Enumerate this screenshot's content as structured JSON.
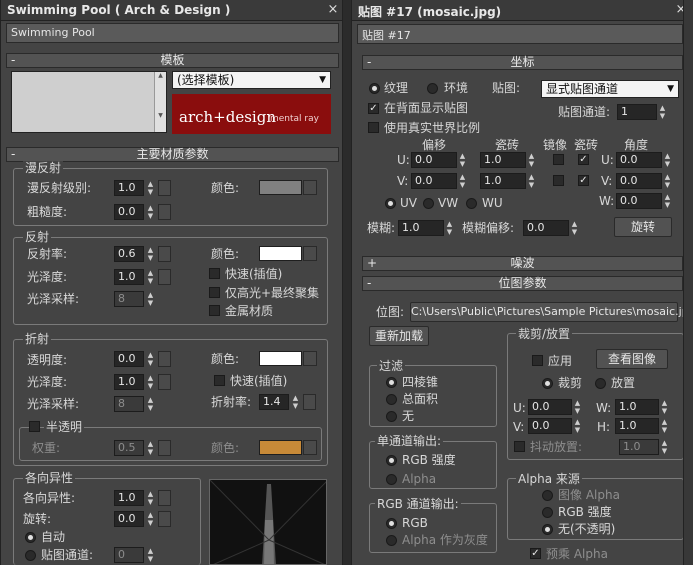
{
  "left": {
    "title": "Swimming Pool  ( Arch & Design )",
    "name_value": "Swimming Pool",
    "template_rollout": "模板",
    "template_dropdown": "(选择模板)",
    "logo_text": "arch+design",
    "logo_sub": "mental ray",
    "main_rollout": "主要材质参数",
    "diffuse": {
      "group": "漫反射",
      "level_label": "漫反射级别:",
      "level_value": "1.0",
      "rough_label": "粗糙度:",
      "rough_value": "0.0",
      "color_label": "颜色:",
      "color": "#808080"
    },
    "reflection": {
      "group": "反射",
      "refl_label": "反射率:",
      "refl_value": "0.6",
      "gloss_label": "光泽度:",
      "gloss_value": "1.0",
      "samples_label": "光泽采样:",
      "samples_value": "8",
      "color_label": "颜色:",
      "color": "#ffffff",
      "fast_interp": "快速(插值)",
      "highlights_fg": "仅高光+最终聚集",
      "metal": "金属材质"
    },
    "refraction": {
      "group": "折射",
      "transp_label": "透明度:",
      "transp_value": "0.0",
      "gloss_label": "光泽度:",
      "gloss_value": "1.0",
      "samples_label": "光泽采样:",
      "samples_value": "8",
      "color_label": "颜色:",
      "color": "#ffffff",
      "fast_interp": "快速(插值)",
      "ior_label": "折射率:",
      "ior_value": "1.4",
      "translucency": "半透明",
      "weight_label": "权重:",
      "weight_value": "0.5",
      "tcolor_label": "颜色:",
      "tcolor": "#c88a38"
    },
    "aniso": {
      "group": "各向异性",
      "aniso_label": "各向异性:",
      "aniso_value": "1.0",
      "rot_label": "旋转:",
      "rot_value": "0.0",
      "auto": "自动",
      "mapchan": "贴图通道:",
      "mapchan_value": "0"
    }
  },
  "right": {
    "title": "贴图 #17 (mosaic.jpg)",
    "name_value": "贴图 #17",
    "coords_rollout": "坐标",
    "texture": "纹理",
    "environ": "环境",
    "map_label": "贴图:",
    "map_dropdown": "显式贴图通道",
    "show_back": "在背面显示贴图",
    "map_channel_label": "贴图通道:",
    "map_channel_value": "1",
    "real_world": "使用真实世界比例",
    "offset_hdr": "偏移",
    "tiling_hdr": "瓷砖",
    "mirror_hdr": "镜像",
    "tile_hdr": "瓷砖",
    "angle_hdr": "角度",
    "u_label": "U:",
    "v_label": "V:",
    "w_label": "W:",
    "u_offset": "0.0",
    "v_offset": "0.0",
    "u_tiling": "1.0",
    "v_tiling": "1.0",
    "u_angle": "0.0",
    "v_angle": "0.0",
    "w_angle": "0.0",
    "uv": "UV",
    "vw": "VW",
    "wu": "WU",
    "blur_label": "模糊:",
    "blur_value": "1.0",
    "blur_off_label": "模糊偏移:",
    "blur_off_value": "0.0",
    "rotate_btn": "旋转",
    "noise_rollout": "噪波",
    "bitmap_rollout": "位图参数",
    "bitmap_label": "位图:",
    "bitmap_path": "C:\\Users\\Public\\Pictures\\Sample Pictures\\mosaic.jpg",
    "reload_btn": "重新加载",
    "filter_group": "过滤",
    "pyramid": "四棱锥",
    "sat": "总面积",
    "none": "无",
    "mono_group": "单通道输出:",
    "rgb_intensity": "RGB 强度",
    "alpha": "Alpha",
    "rgbout_group": "RGB 通道输出:",
    "rgb": "RGB",
    "alpha_gray": "Alpha 作为灰度",
    "crop_group": "裁剪/放置",
    "apply": "应用",
    "view_image": "查看图像",
    "crop": "裁剪",
    "place": "放置",
    "u_crop": "0.0",
    "v_crop": "0.0",
    "w_crop": "1.0",
    "h_crop": "1.0",
    "h_label": "H:",
    "jitter": "抖动放置:",
    "jitter_value": "1.0",
    "alpha_src_group": "Alpha 来源",
    "img_alpha": "图像 Alpha",
    "rgb_int2": "RGB 强度",
    "none_opaque": "无(不透明)",
    "premult": "预乘 Alpha"
  }
}
